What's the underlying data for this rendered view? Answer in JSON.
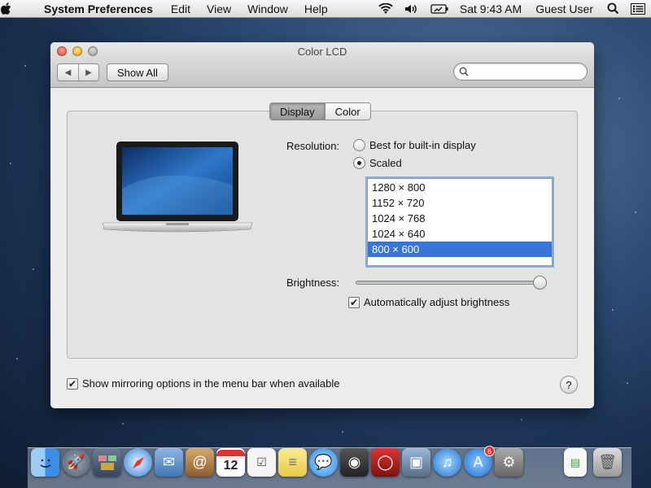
{
  "menubar": {
    "app_name": "System Preferences",
    "menus": [
      "Edit",
      "View",
      "Window",
      "Help"
    ],
    "clock": "Sat 9:43 AM",
    "user": "Guest User"
  },
  "window": {
    "title": "Color LCD",
    "show_all_label": "Show All",
    "search_placeholder": "",
    "tabs": [
      {
        "label": "Display",
        "selected": true
      },
      {
        "label": "Color",
        "selected": false
      }
    ]
  },
  "display": {
    "resolution_label": "Resolution:",
    "options": [
      {
        "label": "Best for built-in display",
        "selected": false
      },
      {
        "label": "Scaled",
        "selected": true
      }
    ],
    "resolutions": [
      "1280 × 800",
      "1152 × 720",
      "1024 × 768",
      "1024 × 640",
      "800 × 600"
    ],
    "selected_resolution": "800 × 600",
    "brightness_label": "Brightness:",
    "brightness_level": 1.0,
    "auto_brightness_label": "Automatically adjust brightness",
    "auto_brightness_checked": true,
    "mirroring_label": "Show mirroring options in the menu bar when available",
    "mirroring_checked": true,
    "help_label": "?"
  },
  "dock": {
    "apps": [
      {
        "name": "Finder",
        "icon": "finder-icon",
        "color": "#3a8ee6"
      },
      {
        "name": "Launchpad",
        "icon": "launchpad-icon",
        "color": "#6c7a8c"
      },
      {
        "name": "Mission Control",
        "icon": "mission-control-icon",
        "color": "#4a5e74"
      },
      {
        "name": "Safari",
        "icon": "safari-icon",
        "color": "#2f7fd9"
      },
      {
        "name": "Mail",
        "icon": "mail-icon",
        "color": "#5a8fd1"
      },
      {
        "name": "Contacts",
        "icon": "contacts-icon",
        "color": "#b9864a"
      },
      {
        "name": "Calendar",
        "icon": "calendar-icon",
        "color": "#ffffff",
        "text": "12"
      },
      {
        "name": "Reminders",
        "icon": "reminders-icon",
        "color": "#f4f4f4"
      },
      {
        "name": "Notes",
        "icon": "notes-icon",
        "color": "#f5e37a"
      },
      {
        "name": "Messages",
        "icon": "messages-icon",
        "color": "#4aa8ee"
      },
      {
        "name": "FaceTime",
        "icon": "facetime-icon",
        "color": "#3b3b3b"
      },
      {
        "name": "Photo Booth",
        "icon": "photo-booth-icon",
        "color": "#b8231f"
      },
      {
        "name": "iPhoto",
        "icon": "iphoto-icon",
        "color": "#7a9ab8"
      },
      {
        "name": "iTunes",
        "icon": "itunes-icon",
        "color": "#2d8be0"
      },
      {
        "name": "App Store",
        "icon": "app-store-icon",
        "color": "#2b86e3",
        "badge": "6"
      },
      {
        "name": "System Preferences",
        "icon": "system-preferences-icon",
        "color": "#8a8a8a"
      }
    ],
    "right": [
      {
        "name": "Document",
        "icon": "document-icon",
        "color": "#f7f7f7"
      },
      {
        "name": "Trash",
        "icon": "trash-icon",
        "color": "#c9c9c9"
      }
    ]
  }
}
